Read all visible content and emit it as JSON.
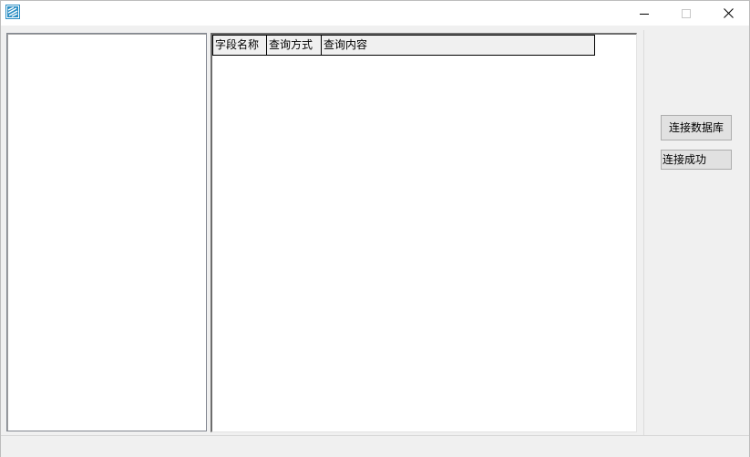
{
  "window": {
    "icons": {
      "app": "app-logo-icon",
      "minimize": "minimize-icon",
      "maximize": "maximize-icon",
      "close": "close-icon"
    }
  },
  "grid": {
    "columns": [
      "字段名称",
      "查询方式",
      "查询内容"
    ]
  },
  "buttons": {
    "connect_db": "连接数据库"
  },
  "status": {
    "text": "连接成功"
  },
  "colors": {
    "window_bg": "#f0f0f0",
    "titlebar_bg": "#ffffff",
    "icon_accent": "#2a8ec4"
  }
}
